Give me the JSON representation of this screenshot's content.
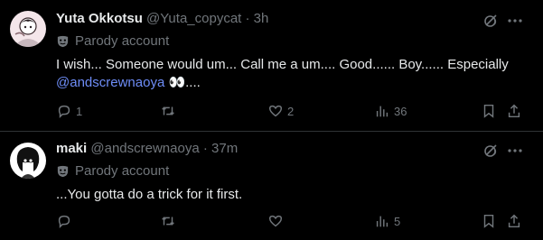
{
  "tweets": [
    {
      "name": "Yuta Okkotsu",
      "handle": "@Yuta_copycat",
      "time": "3h",
      "parody": "Parody account",
      "text_before": "I wish... Someone would um... Call me a um.... Good...... Boy...... Especially",
      "mention": "@andscrewnaoya",
      "text_after": " 👀....",
      "actions": {
        "replies": "1",
        "reposts": "",
        "likes": "2",
        "views": "36"
      }
    },
    {
      "name": "maki",
      "handle": "@andscrewnaoya",
      "time": "37m",
      "parody": "Parody account",
      "text": "...You gotta do a trick for it first.",
      "actions": {
        "replies": "",
        "reposts": "",
        "likes": "",
        "views": "5"
      }
    }
  ],
  "dot": "·",
  "colors": {
    "background": "#000000",
    "text": "#e7e9ea",
    "muted": "#71767b",
    "mention": "#6e8df7",
    "divider": "#2f3336"
  },
  "icons": [
    "grok-icon",
    "more-icon",
    "mask-icon",
    "reply-icon",
    "repost-icon",
    "like-icon",
    "views-icon",
    "bookmark-icon",
    "share-icon"
  ]
}
